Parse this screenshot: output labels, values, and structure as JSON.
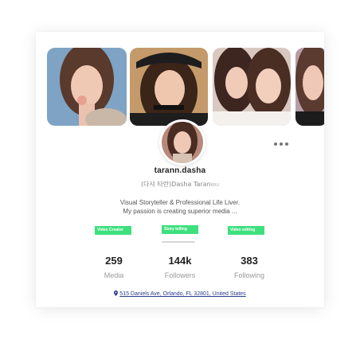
{
  "profile": {
    "username": "tarann.dasha",
    "subname_main": "(다샤 타란)Dasha Taran",
    "subname_suffix": "KRU",
    "bio_line1": "Visual Storyteller & Professional Life Liver.",
    "bio_line2": "My passion is creating superior media ..."
  },
  "tags": [
    "Video Creator",
    "Story telling",
    "Video editing"
  ],
  "stats": [
    {
      "value": "259",
      "label": "Media"
    },
    {
      "value": "144k",
      "label": "Followers"
    },
    {
      "value": "383",
      "label": "Following"
    }
  ],
  "address": "515 Daniels Ave, Orlando, FL 32801, United States",
  "colors": {
    "tag": "#3ee07e",
    "link": "#2c3e8c"
  }
}
